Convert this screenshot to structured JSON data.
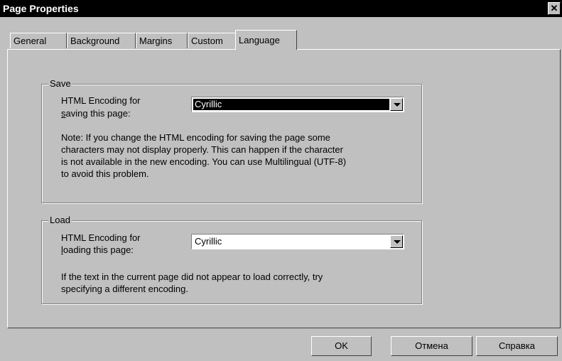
{
  "window": {
    "title": "Page Properties",
    "close_symbol": "✕"
  },
  "tabs": [
    {
      "label": "General"
    },
    {
      "label": "Background"
    },
    {
      "label": "Margins"
    },
    {
      "label": "Custom"
    },
    {
      "label": "Language"
    }
  ],
  "save_group": {
    "title": "Save",
    "label_line1": "HTML Encoding for",
    "label_line2_ul": "s",
    "label_line2_rest": "aving this page:",
    "encoding_value": "Cyrillic",
    "note_lines": [
      "Note: If you change the HTML encoding for saving the page some",
      "characters may not display properly.  This can happen if the character",
      "is not available in the new encoding.  You can use Multilingual (UTF-8)",
      "to avoid this problem."
    ]
  },
  "load_group": {
    "title": "Load",
    "label_line1": "HTML Encoding for",
    "label_line2_ul": "l",
    "label_line2_rest": "oading this page:",
    "encoding_value": "Cyrillic",
    "note_lines": [
      "If the text in the current page did not appear to load correctly, try",
      "specifying a different encoding."
    ]
  },
  "buttons": {
    "ok": "OK",
    "cancel": "Отмена",
    "help": "Справка"
  }
}
